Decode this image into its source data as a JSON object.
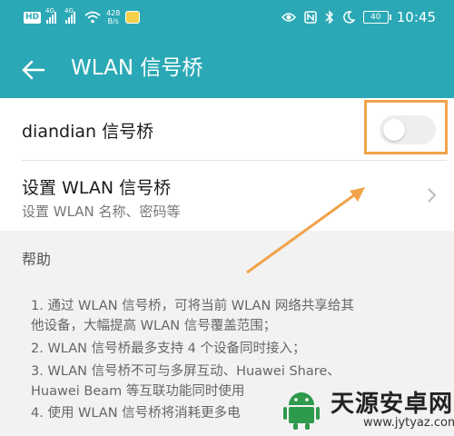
{
  "status_bar": {
    "hd": "HD",
    "signal_gen_1": "4G",
    "signal_gen_2": "4G",
    "net_speed_value": "428",
    "net_speed_unit": "B/s",
    "battery": "40",
    "time": "10:45",
    "icons": [
      "eye-icon",
      "nfc-icon",
      "bluetooth-icon",
      "moon-icon"
    ]
  },
  "title_bar": {
    "title": "WLAN 信号桥"
  },
  "hotspot_row": {
    "label": "diandian 信号桥",
    "toggle_on": false
  },
  "setup_row": {
    "title": "设置 WLAN 信号桥",
    "subtitle": "设置 WLAN 名称、密码等"
  },
  "help": {
    "header": "帮助",
    "lines": [
      "1. 通过 WLAN 信号桥，可将当前 WLAN 网络共享给其",
      "他设备，大幅提高 WLAN 信号覆盖范围；",
      "2. WLAN 信号桥最多支持 4 个设备同时接入；",
      "3. WLAN 信号桥不可与多屏互动、Huawei Share、",
      "Huawei Beam 等互联功能同时使用",
      "4. 使用 WLAN 信号桥将消耗更多电"
    ]
  },
  "watermark": {
    "title": "天源安卓网",
    "url": "www.jytyaz.com"
  },
  "colors": {
    "header": "#2aa8b5",
    "highlight": "#f0a34a",
    "background": "#ffffff",
    "section": "#f2f2f2"
  }
}
